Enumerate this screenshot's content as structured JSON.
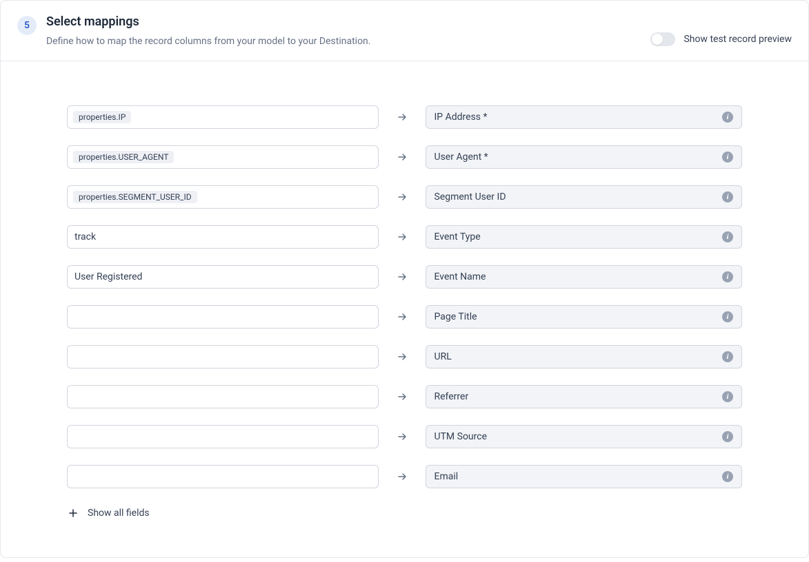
{
  "step": "5",
  "header": {
    "title": "Select mappings",
    "subtitle": "Define how to map the record columns from your model to your Destination.",
    "toggle_label": "Show test record preview"
  },
  "mappings": [
    {
      "source": "properties.IP",
      "source_type": "chip",
      "dest": "IP Address *"
    },
    {
      "source": "properties.USER_AGENT",
      "source_type": "chip",
      "dest": "User Agent *"
    },
    {
      "source": "properties.SEGMENT_USER_ID",
      "source_type": "chip",
      "dest": "Segment User ID"
    },
    {
      "source": "track",
      "source_type": "text",
      "dest": "Event Type"
    },
    {
      "source": "User Registered",
      "source_type": "text",
      "dest": "Event Name"
    },
    {
      "source": "",
      "source_type": "text",
      "dest": "Page Title"
    },
    {
      "source": "",
      "source_type": "text",
      "dest": "URL"
    },
    {
      "source": "",
      "source_type": "text",
      "dest": "Referrer"
    },
    {
      "source": "",
      "source_type": "text",
      "dest": "UTM Source"
    },
    {
      "source": "",
      "source_type": "text",
      "dest": "Email"
    }
  ],
  "show_all_label": "Show all fields"
}
